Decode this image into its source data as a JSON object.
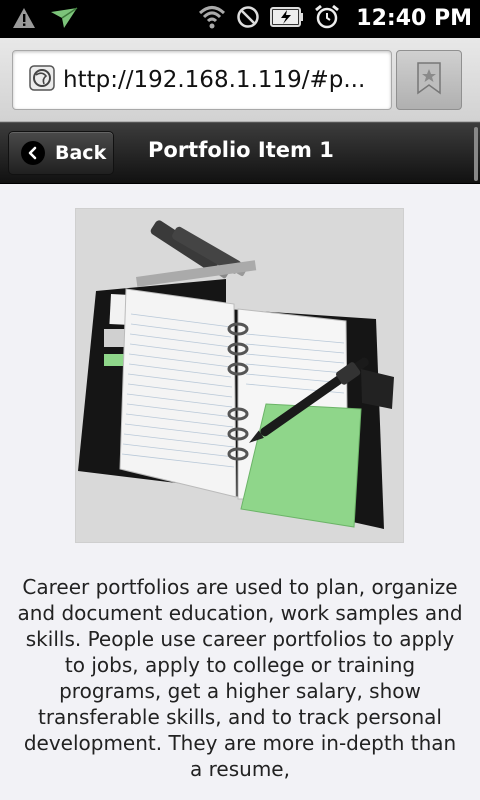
{
  "status_bar": {
    "time": "12:40 PM",
    "icons": [
      "warning-icon",
      "notification-plane-icon",
      "wifi-icon",
      "do-not-disturb-icon",
      "battery-charging-icon",
      "alarm-icon"
    ]
  },
  "browser": {
    "url": "http://192.168.1.119/#p...",
    "bookmark_icon": "bookmark-star-icon"
  },
  "header": {
    "back_label": "Back",
    "title": "Portfolio Item 1"
  },
  "content": {
    "image_icon": "portfolio-binder-photo",
    "body": "Career portfolios are used to plan, organize and document education, work samples and skills. People use career portfolios to apply to jobs, apply to college or training programs, get a higher salary, show transferable skills, and to track personal development. They are more in-depth than a resume,"
  },
  "colors": {
    "header_bg": "#1c1c1c",
    "content_bg": "#f2f2f6",
    "sticky_note": "#8fd68a"
  }
}
